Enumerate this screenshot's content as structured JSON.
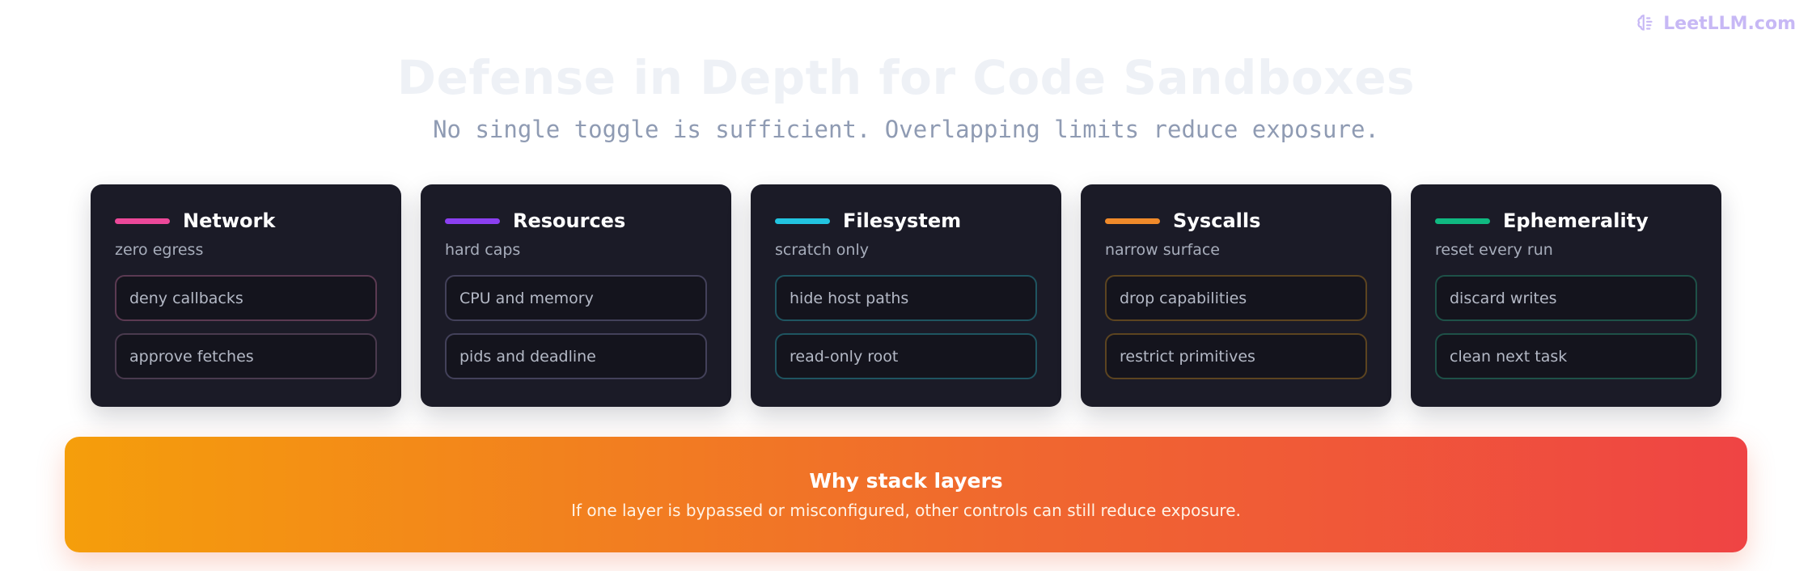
{
  "brand": {
    "text": "LeetLLM.com",
    "icon": "brain-icon"
  },
  "title": "Defense in Depth for Code Sandboxes",
  "subtitle": "No single toggle is sufficient. Overlapping limits reduce exposure.",
  "cards": [
    {
      "title": "Network",
      "subtitle": "zero egress",
      "accent": "#ec4899",
      "border": "#5b3a52",
      "items": [
        "deny callbacks",
        "approve fetches"
      ]
    },
    {
      "title": "Resources",
      "subtitle": "hard caps",
      "accent": "#8b3ff0",
      "border": "#43415a",
      "items": [
        "CPU and memory",
        "pids and deadline"
      ]
    },
    {
      "title": "Filesystem",
      "subtitle": "scratch only",
      "accent": "#22c4e0",
      "border": "#1f5561",
      "items": [
        "hide host paths",
        "read-only root"
      ]
    },
    {
      "title": "Syscalls",
      "subtitle": "narrow surface",
      "accent": "#f08a2a",
      "border": "#5c4420",
      "items": [
        "drop capabilities",
        "restrict primitives"
      ]
    },
    {
      "title": "Ephemerality",
      "subtitle": "reset every run",
      "accent": "#10b981",
      "border": "#1e5148",
      "items": [
        "discard writes",
        "clean next task"
      ]
    }
  ],
  "banner": {
    "title": "Why stack layers",
    "text": "If one layer is bypassed or misconfigured, other controls can still reduce exposure."
  }
}
